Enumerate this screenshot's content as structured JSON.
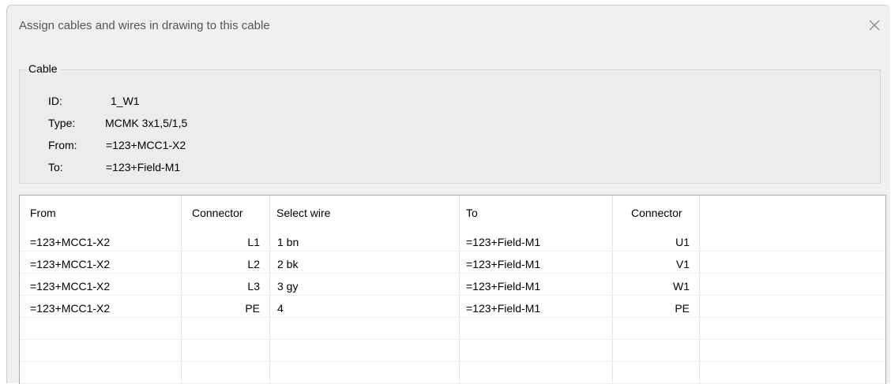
{
  "dialog": {
    "title": "Assign cables and wires in drawing to this cable"
  },
  "cable": {
    "legend": "Cable",
    "fields": [
      {
        "label": "ID:",
        "value": "1_W1"
      },
      {
        "label": "Type:",
        "value": "MCMK 3x1,5/1,5"
      },
      {
        "label": "From:",
        "value": "=123+MCC1-X2"
      },
      {
        "label": "To:",
        "value": "=123+Field-M1"
      }
    ]
  },
  "table": {
    "headers": [
      "From",
      "Connector",
      "Select wire",
      "To",
      "Connector"
    ],
    "rows": [
      [
        "=123+MCC1-X2",
        "L1",
        "1 bn",
        "=123+Field-M1",
        "U1"
      ],
      [
        "=123+MCC1-X2",
        "L2",
        "2 bk",
        "=123+Field-M1",
        "V1"
      ],
      [
        "=123+MCC1-X2",
        "L3",
        "3 gy",
        "=123+Field-M1",
        "W1"
      ],
      [
        "=123+MCC1-X2",
        "PE",
        "4",
        "=123+Field-M1",
        "PE"
      ]
    ]
  },
  "icons": {
    "close": "close-icon"
  }
}
